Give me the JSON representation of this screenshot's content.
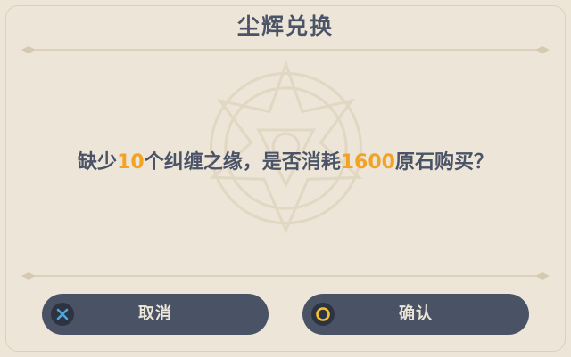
{
  "dialog": {
    "title": "尘辉兑换",
    "message": {
      "prefix": "缺少",
      "item_count": "10",
      "item_text": "个纠缠之缘，是否消耗",
      "cost": "1600",
      "suffix": "原石购买？"
    }
  },
  "buttons": {
    "cancel_label": "取消",
    "cancel_icon": "cross-icon",
    "confirm_label": "确认",
    "confirm_icon": "circle-icon"
  },
  "colors": {
    "background": "#ece5d8",
    "text": "#4b5366",
    "highlight": "#f2a324",
    "button": "#4a5366",
    "cancel_icon": "#4aa8e0",
    "confirm_icon": "#f2c233"
  }
}
